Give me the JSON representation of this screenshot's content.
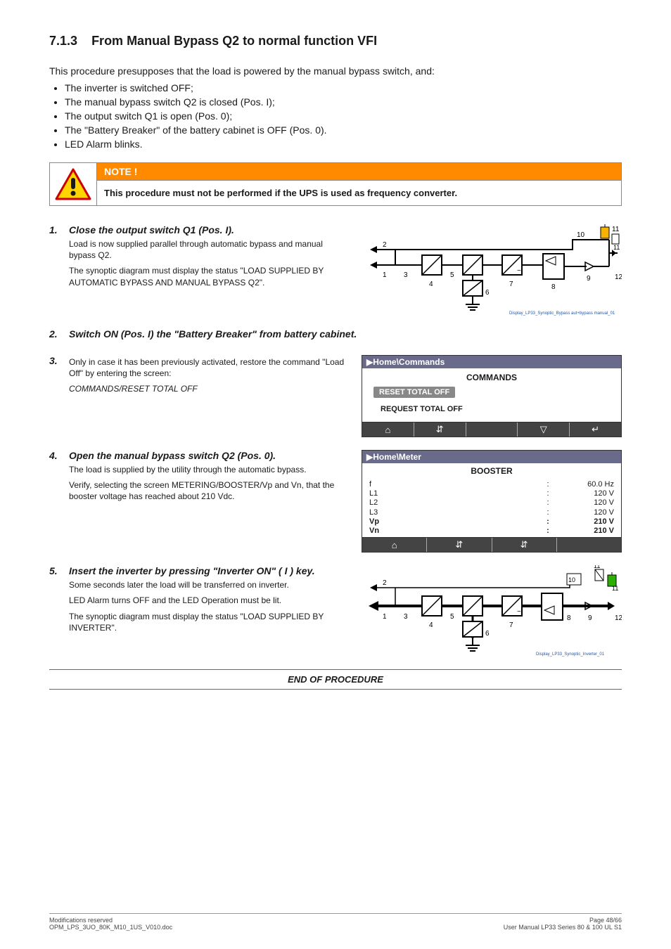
{
  "heading": {
    "number": "7.1.3",
    "title": "From Manual Bypass Q2 to normal function VFI"
  },
  "intro": "This procedure presupposes that the load is powered by the manual bypass switch, and:",
  "bullets": [
    "The inverter is switched OFF;",
    "The manual bypass switch Q2 is closed (Pos. I);",
    "The output switch Q1 is open (Pos. 0);",
    "The \"Battery Breaker\" of the battery cabinet is OFF (Pos. 0).",
    "LED Alarm blinks."
  ],
  "note": {
    "label": "NOTE !",
    "text": "This procedure must not be performed if the UPS is used as frequency converter."
  },
  "steps": {
    "s1": {
      "num": "1.",
      "title": "Close the output switch Q1 (Pos. I).",
      "p1": "Load is now supplied parallel through automatic bypass and manual bypass Q2.",
      "p2": "The synoptic diagram must display the status \"LOAD SUPPLIED BY AUTOMATIC BYPASS AND MANUAL BYPASS Q2\"."
    },
    "s2": {
      "num": "2.",
      "title": "Switch ON (Pos. I) the \"Battery Breaker\" from battery cabinet."
    },
    "s3": {
      "num": "3.",
      "p1": "Only in case it has been previously activated, restore the command \"Load Off\" by entering the screen:",
      "p2": "COMMANDS/RESET TOTAL OFF"
    },
    "s4": {
      "num": "4.",
      "title": "Open the manual bypass switch Q2 (Pos. 0).",
      "p1": "The load is supplied by the utility through the automatic bypass.",
      "p2": "Verify, selecting the screen METERING/BOOSTER/Vp and Vn, that the booster voltage has reached about 210 Vdc."
    },
    "s5": {
      "num": "5.",
      "title": "Insert the inverter by pressing \"Inverter ON\" ( I ) key.",
      "p1": "Some seconds later the load will be transferred on inverter.",
      "p2": "LED Alarm turns OFF and the LED Operation must be lit.",
      "p3": "The synoptic diagram must display the status \"LOAD SUPPLIED BY INVERTER\"."
    }
  },
  "lcd_commands": {
    "breadcrumb": "▶Home\\Commands",
    "title": "COMMANDS",
    "btn": "RESET TOTAL OFF",
    "plain": "REQUEST TOTAL OFF"
  },
  "lcd_meter": {
    "breadcrumb": "▶Home\\Meter",
    "title": "BOOSTER",
    "rows": [
      {
        "label": "f",
        "sep": ":",
        "val": "60.0 Hz",
        "bold": false
      },
      {
        "label": "L1",
        "sep": ":",
        "val": "120 V",
        "bold": false
      },
      {
        "label": "L2",
        "sep": ":",
        "val": "120 V",
        "bold": false
      },
      {
        "label": "L3",
        "sep": ":",
        "val": "120 V",
        "bold": false
      },
      {
        "label": "Vp",
        "sep": ":",
        "val": "210 V",
        "bold": true
      },
      {
        "label": "Vn",
        "sep": ":",
        "val": "210 V",
        "bold": true
      }
    ]
  },
  "end": "END OF PROCEDURE",
  "diagram_labels": {
    "n1": "1",
    "n2": "2",
    "n3": "3",
    "n4": "4",
    "n5": "5",
    "n6": "6",
    "n7": "7",
    "n8": "8",
    "n9": "9",
    "n10": "10",
    "n11": "11",
    "n12": "12",
    "caption1": "Display_LP33_Synoptic_Bypass aut+bypass manual_01",
    "caption2": "Display_LP33_Synoptic_Inverter_01"
  },
  "footer": {
    "left1": "Modifications reserved",
    "left2": "OPM_LPS_3UO_80K_M10_1US_V010.doc",
    "right1": "Page 48/66",
    "right2": "User Manual LP33 Series 80 & 100 UL S1"
  }
}
